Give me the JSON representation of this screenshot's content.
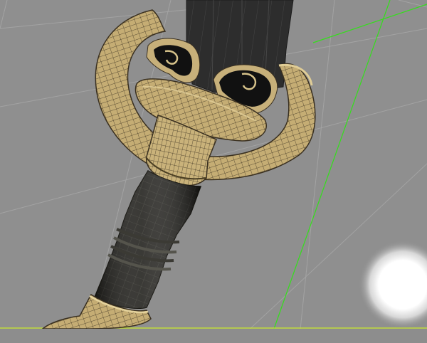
{
  "viewport": {
    "background_color": "#8f8f8f",
    "grid_line_color": "#a0a0a0",
    "axis_line_color": "#33e01a",
    "ground_line_color": "#c9ea2a",
    "light_color": "#ffffff"
  },
  "model": {
    "blade_color": "#2a2a2a",
    "metal_color": "#c9b27a",
    "metal_dark_color": "#5e4e2a",
    "wire_color": "#3a3020",
    "grip_color": "#262420",
    "grip_highlight_color": "#5a5a52",
    "icon": "sword-hilt-icon"
  }
}
